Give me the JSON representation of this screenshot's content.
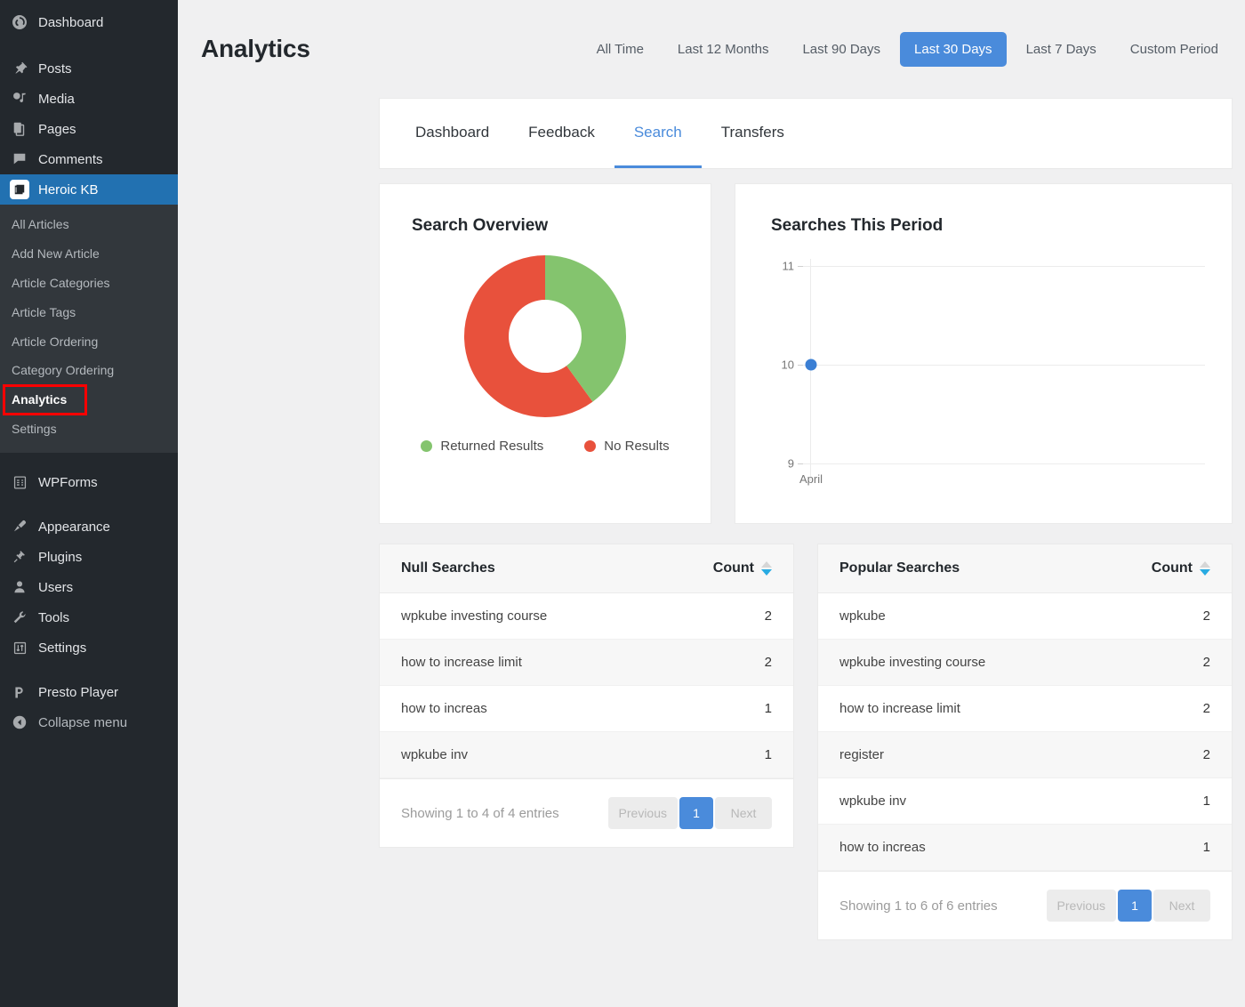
{
  "sidebar": {
    "items": [
      {
        "label": "Dashboard",
        "icon": "dashboard-icon"
      },
      {
        "label": "Posts",
        "icon": "pin-icon"
      },
      {
        "label": "Media",
        "icon": "media-icon"
      },
      {
        "label": "Pages",
        "icon": "pages-icon"
      },
      {
        "label": "Comments",
        "icon": "comments-icon"
      },
      {
        "label": "Heroic KB",
        "icon": "book-icon",
        "current": true
      }
    ],
    "submenu": [
      {
        "label": "All Articles"
      },
      {
        "label": "Add New Article"
      },
      {
        "label": "Article Categories"
      },
      {
        "label": "Article Tags"
      },
      {
        "label": "Article Ordering"
      },
      {
        "label": "Category Ordering"
      },
      {
        "label": "Analytics",
        "highlighted": true
      },
      {
        "label": "Settings"
      }
    ],
    "items_lower": [
      {
        "label": "WPForms",
        "icon": "form-icon"
      },
      {
        "label": "Appearance",
        "icon": "brush-icon"
      },
      {
        "label": "Plugins",
        "icon": "plug-icon"
      },
      {
        "label": "Users",
        "icon": "user-icon"
      },
      {
        "label": "Tools",
        "icon": "wrench-icon"
      },
      {
        "label": "Settings",
        "icon": "sliders-icon"
      },
      {
        "label": "Presto Player",
        "icon": "presto-icon"
      },
      {
        "label": "Collapse menu",
        "icon": "collapse-arrow-icon"
      }
    ],
    "highlight_color": "#ff0000",
    "current_color": "#2271b1"
  },
  "header": {
    "title": "Analytics",
    "periods": [
      {
        "label": "All Time",
        "active": false
      },
      {
        "label": "Last 12 Months",
        "active": false
      },
      {
        "label": "Last 90 Days",
        "active": false
      },
      {
        "label": "Last 30 Days",
        "active": true
      },
      {
        "label": "Last 7 Days",
        "active": false
      },
      {
        "label": "Custom Period",
        "active": false
      }
    ],
    "accent_color": "#4a8bdb"
  },
  "tabs": [
    {
      "label": "Dashboard",
      "active": false
    },
    {
      "label": "Feedback",
      "active": false
    },
    {
      "label": "Search",
      "active": true
    },
    {
      "label": "Transfers",
      "active": false
    }
  ],
  "overview": {
    "title": "Search Overview"
  },
  "period_chart": {
    "title": "Searches This Period"
  },
  "chart_data": [
    {
      "type": "pie",
      "title": "Search Overview",
      "labels": [
        "Returned Results",
        "No Results"
      ],
      "values": [
        40,
        60
      ],
      "colors": [
        "#84c46e",
        "#e8513c"
      ],
      "donut": true,
      "legend": "bottom"
    },
    {
      "type": "line",
      "title": "Searches This Period",
      "x": [
        "April"
      ],
      "values": [
        10
      ],
      "xlabel": "",
      "ylabel": "",
      "ylim": [
        9,
        11
      ],
      "yticks": [
        9,
        10,
        11
      ],
      "grid": true,
      "point_color": "#3b7fd4",
      "legend": "none"
    }
  ],
  "null_searches": {
    "title": "Null Searches",
    "count_header": "Count",
    "rows": [
      {
        "term": "wpkube investing course",
        "count": "2"
      },
      {
        "term": "how to increase limit",
        "count": "2"
      },
      {
        "term": "how to increas",
        "count": "1"
      },
      {
        "term": "wpkube inv",
        "count": "1"
      }
    ],
    "entries_text": "Showing 1 to 4 of 4 entries",
    "pagination": {
      "previous": "Previous",
      "page": "1",
      "next": "Next"
    }
  },
  "popular_searches": {
    "title": "Popular Searches",
    "count_header": "Count",
    "rows": [
      {
        "term": "wpkube",
        "count": "2"
      },
      {
        "term": "wpkube investing course",
        "count": "2"
      },
      {
        "term": "how to increase limit",
        "count": "2"
      },
      {
        "term": "register",
        "count": "2"
      },
      {
        "term": "wpkube inv",
        "count": "1"
      },
      {
        "term": "how to increas",
        "count": "1"
      }
    ],
    "entries_text": "Showing 1 to 6 of 6 entries",
    "pagination": {
      "previous": "Previous",
      "page": "1",
      "next": "Next"
    }
  }
}
